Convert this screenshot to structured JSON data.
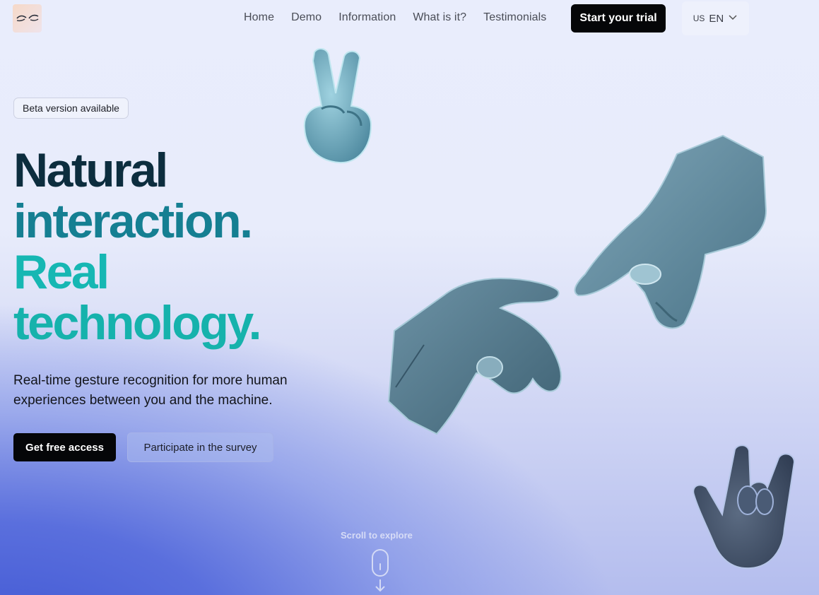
{
  "nav": {
    "links": [
      "Home",
      "Demo",
      "Information",
      "What is it?",
      "Testimonials"
    ],
    "trial_label": "Start your trial",
    "lang_flag": "US",
    "lang_code": "EN"
  },
  "hero": {
    "badge": "Beta version available",
    "headline": [
      "Natural",
      "interaction.",
      "Real",
      "technology."
    ],
    "subtitle": "Real-time gesture recognition for more human experiences between you and the machine.",
    "primary_cta": "Get free access",
    "secondary_cta": "Participate in the survey"
  },
  "scroll": {
    "label": "Scroll to explore"
  },
  "icons": {
    "logo": "hands-logo-icon",
    "lang_dropdown": "chevron-down-icon",
    "scroll_mouse": "mouse-icon",
    "scroll_arrow": "arrow-down-icon"
  },
  "colors": {
    "headline_dark": "#0c2d3e",
    "headline_teal_dark": "#157f92",
    "headline_teal": "#16b7b3",
    "button_black": "#050608",
    "hand_blue": "#5f8598"
  }
}
